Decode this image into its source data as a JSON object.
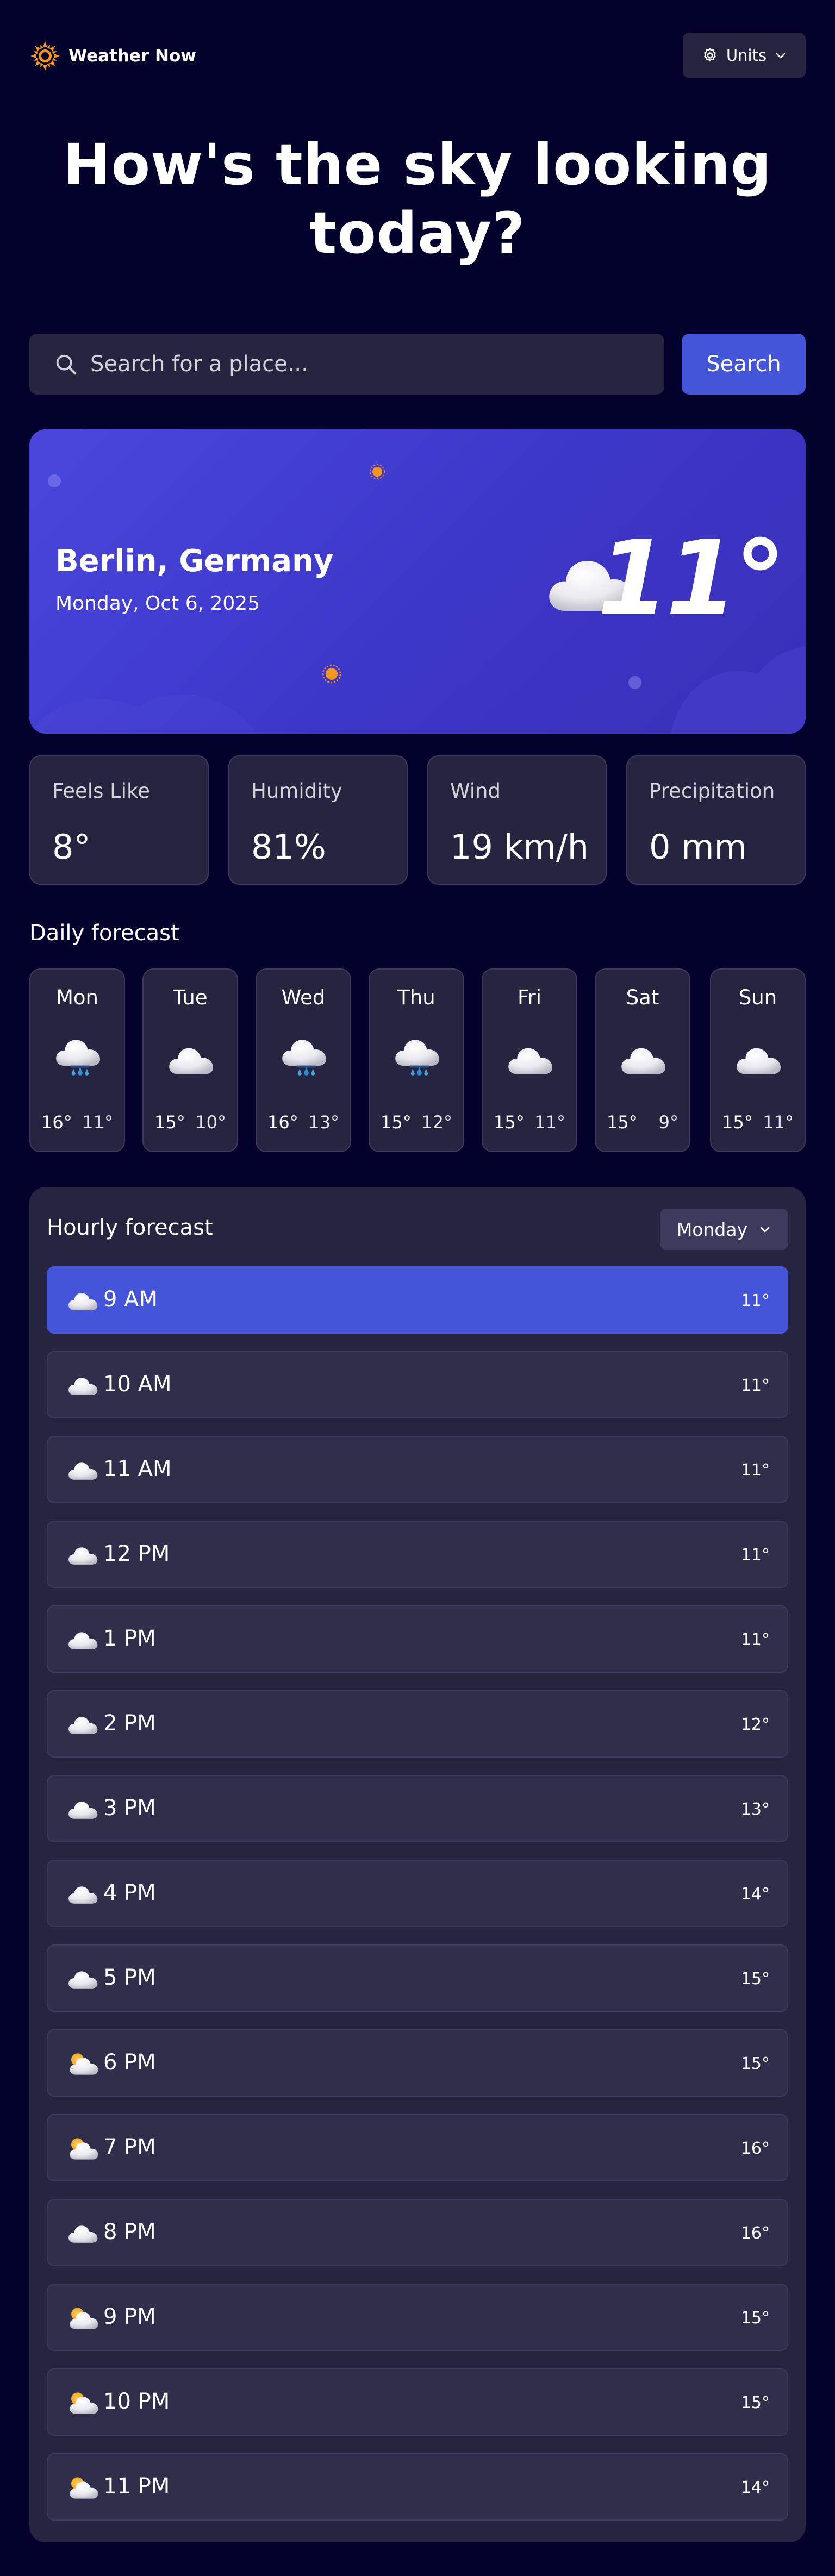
{
  "app": {
    "name": "Weather Now"
  },
  "header": {
    "units_label": "Units"
  },
  "headline": {
    "line1": "How's the sky looking",
    "line2": "today?"
  },
  "search": {
    "placeholder": "Search for a place...",
    "button_label": "Search"
  },
  "current": {
    "location": "Berlin, Germany",
    "date": "Monday, Oct 6, 2025",
    "temperature": "11°",
    "icon": "cloud-icon"
  },
  "stats": [
    {
      "label": "Feels Like",
      "value": "8°"
    },
    {
      "label": "Humidity",
      "value": "81%"
    },
    {
      "label": "Wind",
      "value": "19 km/h"
    },
    {
      "label": "Precipitation",
      "value": "0 mm"
    }
  ],
  "daily": {
    "title": "Daily forecast",
    "days": [
      {
        "day": "Mon",
        "high": "16°",
        "low": "11°",
        "icon": "rain-cloud-icon"
      },
      {
        "day": "Tue",
        "high": "15°",
        "low": "10°",
        "icon": "cloud-icon"
      },
      {
        "day": "Wed",
        "high": "16°",
        "low": "13°",
        "icon": "rain-cloud-icon"
      },
      {
        "day": "Thu",
        "high": "15°",
        "low": "12°",
        "icon": "rain-cloud-icon"
      },
      {
        "day": "Fri",
        "high": "15°",
        "low": "11°",
        "icon": "cloud-icon"
      },
      {
        "day": "Sat",
        "high": "15°",
        "low": "9°",
        "icon": "cloud-icon"
      },
      {
        "day": "Sun",
        "high": "15°",
        "low": "11°",
        "icon": "cloud-icon"
      }
    ]
  },
  "hourly": {
    "title": "Hourly forecast",
    "selected_day": "Monday",
    "hours": [
      {
        "time": "9 AM",
        "temp": "11°",
        "icon": "cloud-icon",
        "active": true
      },
      {
        "time": "10 AM",
        "temp": "11°",
        "icon": "cloud-icon"
      },
      {
        "time": "11 AM",
        "temp": "11°",
        "icon": "cloud-icon"
      },
      {
        "time": "12 PM",
        "temp": "11°",
        "icon": "cloud-icon"
      },
      {
        "time": "1 PM",
        "temp": "11°",
        "icon": "cloud-icon"
      },
      {
        "time": "2 PM",
        "temp": "12°",
        "icon": "cloud-icon"
      },
      {
        "time": "3 PM",
        "temp": "13°",
        "icon": "cloud-icon"
      },
      {
        "time": "4 PM",
        "temp": "14°",
        "icon": "cloud-icon"
      },
      {
        "time": "5 PM",
        "temp": "15°",
        "icon": "cloud-icon"
      },
      {
        "time": "6 PM",
        "temp": "15°",
        "icon": "partly-sunny-icon"
      },
      {
        "time": "7 PM",
        "temp": "16°",
        "icon": "partly-sunny-icon"
      },
      {
        "time": "8 PM",
        "temp": "16°",
        "icon": "cloud-icon"
      },
      {
        "time": "9 PM",
        "temp": "15°",
        "icon": "partly-sunny-icon"
      },
      {
        "time": "10 PM",
        "temp": "15°",
        "icon": "partly-sunny-icon"
      },
      {
        "time": "11 PM",
        "temp": "14°",
        "icon": "partly-sunny-icon"
      }
    ]
  },
  "colors": {
    "background": "#02012b",
    "card": "#262540",
    "accent": "#4455da",
    "sun": "#f5961e"
  }
}
